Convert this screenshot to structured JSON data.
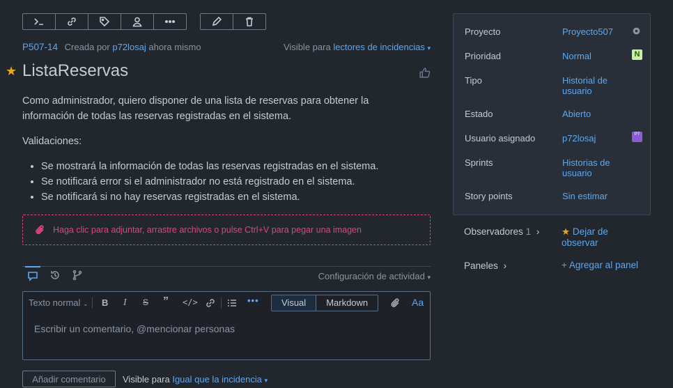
{
  "issue": {
    "id": "P507-14",
    "created_prefix": "Creada por",
    "author": "p72losaj",
    "created_time": "ahora mismo",
    "visible_prefix": "Visible para",
    "visible_value": "lectores de incidencias",
    "title": "ListaReservas",
    "description_p1": "Como administrador, quiero disponer de una lista de reservas para obtener la información de todas las reservas registradas en el sistema.",
    "description_p2": "Validaciones:",
    "bullets": [
      "Se mostrará la información de todas las reservas registradas en el sistema.",
      "Se notificará error si el administrador no está registrado en el sistema.",
      "Se notificará si no hay reservas registradas en el sistema."
    ],
    "attach_text": "Haga clic para adjuntar, arrastre archivos o pulse Ctrl+V para pegar una imagen"
  },
  "activity": {
    "config_label": "Configuración de actividad"
  },
  "editor": {
    "format_label": "Texto normal",
    "visual_label": "Visual",
    "markdown_label": "Markdown",
    "aa_label": "Aa",
    "placeholder": "Escribir un comentario, @mencionar personas",
    "add_comment": "Añadir comentario",
    "visible_prefix": "Visible para",
    "visible_value": "Igual que la incidencia"
  },
  "details": {
    "rows": [
      {
        "label": "Proyecto",
        "value": "Proyecto507"
      },
      {
        "label": "Prioridad",
        "value": "Normal",
        "badge": "N"
      },
      {
        "label": "Tipo",
        "value": "Historial de usuario"
      },
      {
        "label": "Estado",
        "value": "Abierto"
      },
      {
        "label": "Usuario asignado",
        "value": "p72losaj",
        "badge": "P7"
      },
      {
        "label": "Sprints",
        "value": "Historias de usuario"
      },
      {
        "label": "Story points",
        "value": "Sin estimar"
      }
    ],
    "watchers_label": "Observadores",
    "watchers_count": "1",
    "unwatch_label": "Dejar de observar",
    "boards_label": "Paneles",
    "add_board_label": "Agregar al panel"
  },
  "colors": {
    "accent": "#5ea7f0",
    "star": "#e6a817",
    "attach": "#e0447f",
    "priority_badge": "#c7f0a2",
    "avatar_badge": "#8b5cd6"
  }
}
